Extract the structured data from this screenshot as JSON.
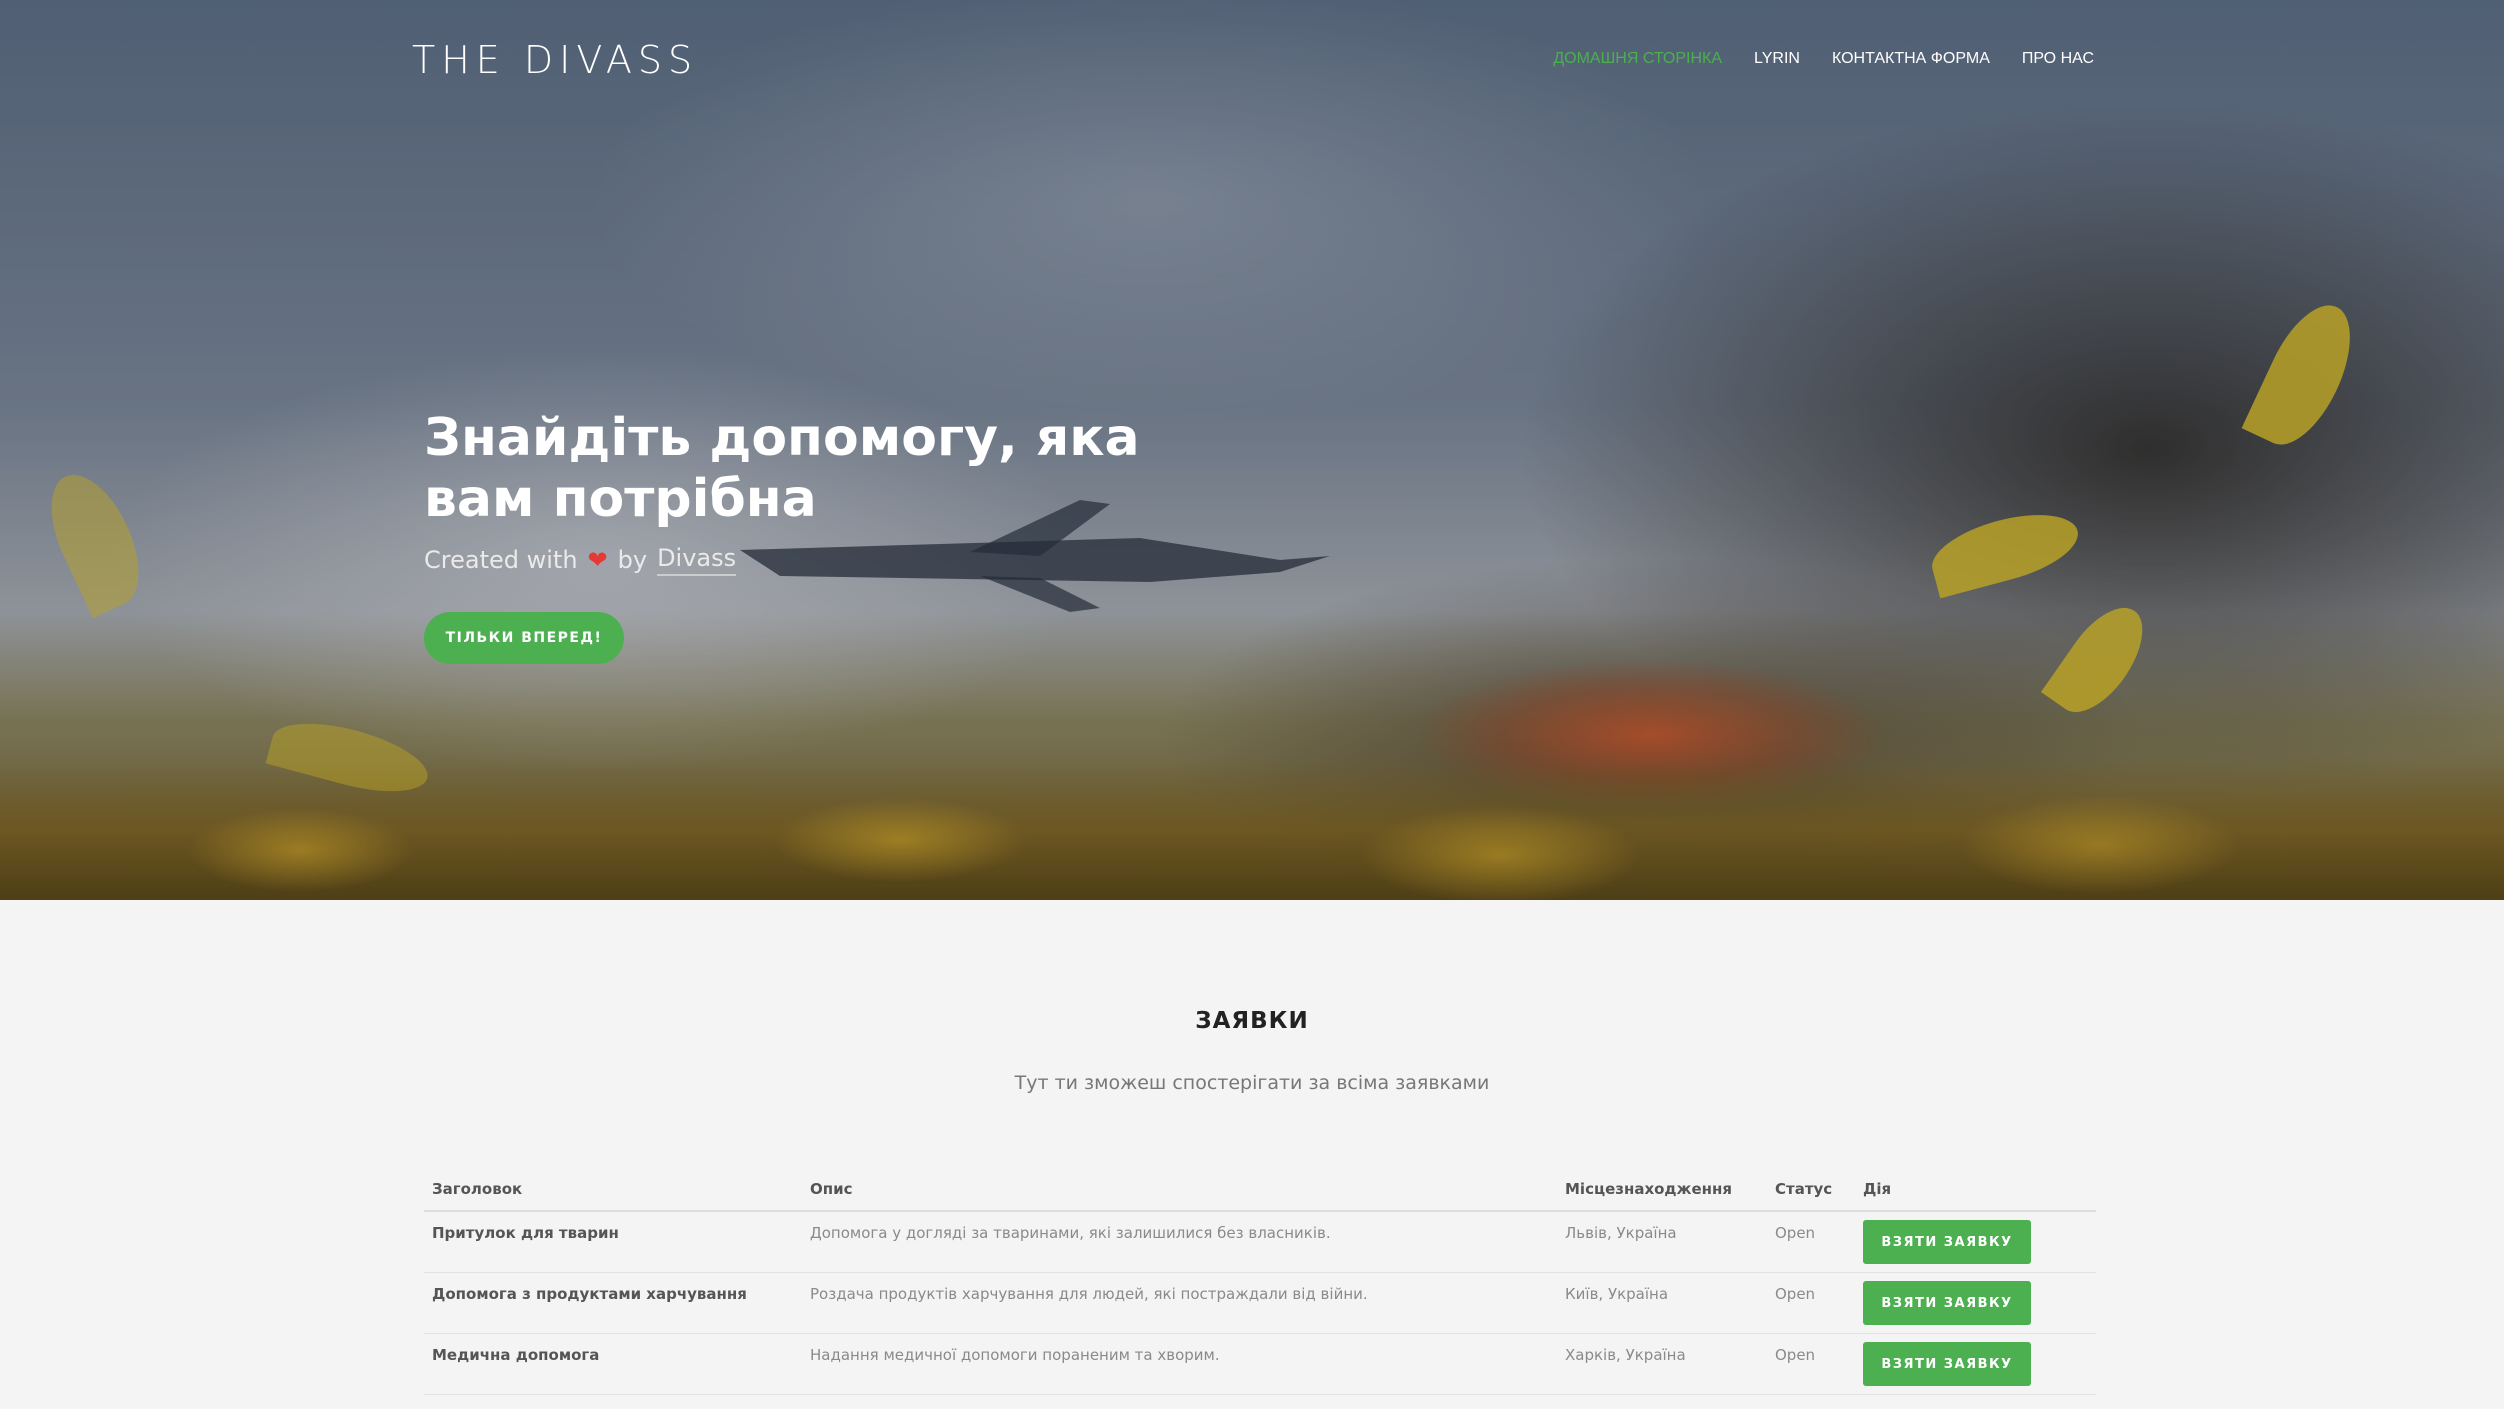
{
  "brand": {
    "logo_text": "THE DIVASS"
  },
  "nav": {
    "items": [
      {
        "label": "ДОМАШНЯ СТОРІНКА",
        "active": true
      },
      {
        "label": "LYRIN",
        "active": false
      },
      {
        "label": "КОНТАКТНА ФОРМА",
        "active": false
      },
      {
        "label": "ПРО НАС",
        "active": false
      }
    ],
    "active_color": "#4caf50"
  },
  "hero": {
    "title": "Знайдіть допомогу, яка вам потрібна",
    "subtitle_prefix": "Created with",
    "subtitle_by": "by",
    "author": "Divass",
    "heart_icon": "heart-icon",
    "cta_label": "ТІЛЬКИ ВПЕРЕД!"
  },
  "requests": {
    "title": "ЗАЯВКИ",
    "subtitle": "Тут ти зможеш спостерігати за всіма заявками",
    "columns": [
      "Заголовок",
      "Опис",
      "Місцезнаходження",
      "Статус",
      "Дія"
    ],
    "rows": [
      {
        "title": "Притулок для тварин",
        "description": "Допомога у догляді за тваринами, які залишилися без власників.",
        "location": "Львів, Україна",
        "status": "Open",
        "action": "ВЗЯТИ ЗАЯВКУ"
      },
      {
        "title": "Допомога з продуктами харчування",
        "description": "Роздача продуктів харчування для людей, які постраждали від війни.",
        "location": "Київ, Україна",
        "status": "Open",
        "action": "ВЗЯТИ ЗАЯВКУ"
      },
      {
        "title": "Медична допомога",
        "description": "Надання медичної допомоги пораненим та хворим.",
        "location": "Харків, Україна",
        "status": "Open",
        "action": "ВЗЯТИ ЗАЯВКУ"
      }
    ],
    "button_color": "#4caf50"
  }
}
